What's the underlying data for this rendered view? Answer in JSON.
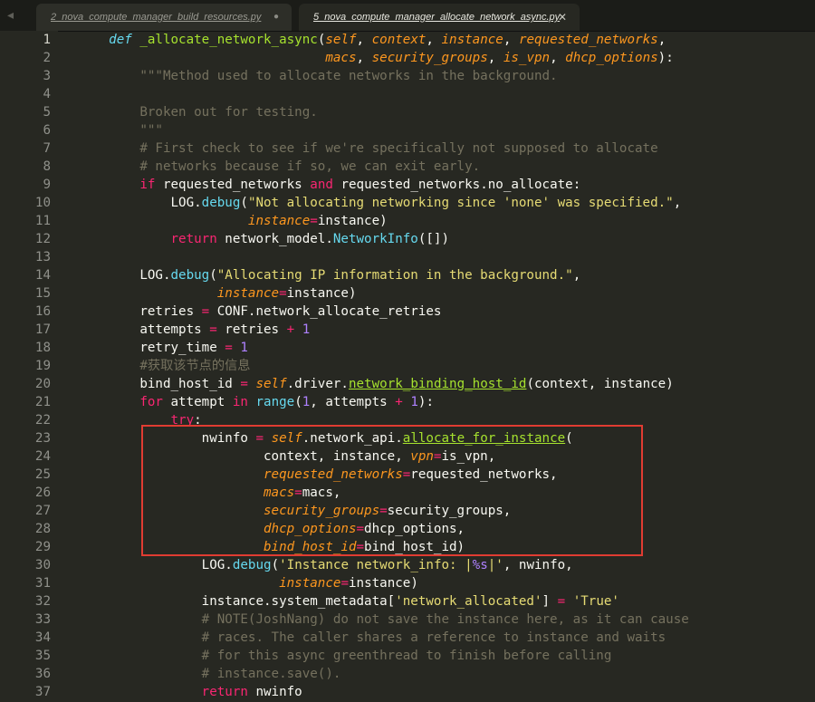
{
  "tabs": [
    {
      "label": "2_nova_compute_manager_build_resources.py",
      "state": "modified",
      "mark": "●"
    },
    {
      "label": "5_nova_compute_manager_allocate_network_async.py",
      "state": "active",
      "mark": "✕"
    }
  ],
  "line_numbers": [
    "1",
    "2",
    "3",
    "4",
    "5",
    "6",
    "7",
    "8",
    "9",
    "10",
    "11",
    "12",
    "13",
    "14",
    "15",
    "16",
    "17",
    "18",
    "19",
    "20",
    "21",
    "22",
    "23",
    "24",
    "25",
    "26",
    "27",
    "28",
    "29",
    "30",
    "31",
    "32",
    "33",
    "34",
    "35",
    "36",
    "37"
  ],
  "active_line": "1",
  "highlight_box": {
    "color": "#e03c32",
    "from_line": "23",
    "to_line": "29"
  },
  "code": [
    [
      [
        "    ",
        ""
      ],
      [
        "def",
        "d"
      ],
      [
        " ",
        ""
      ],
      [
        "_allocate_network_async",
        "f"
      ],
      [
        "(",
        ""
      ],
      [
        "self",
        "p"
      ],
      [
        ", ",
        ""
      ],
      [
        "context",
        "p"
      ],
      [
        ", ",
        ""
      ],
      [
        "instance",
        "p"
      ],
      [
        ", ",
        ""
      ],
      [
        "requested_networks",
        "p"
      ],
      [
        ",",
        ""
      ]
    ],
    [
      [
        "                                ",
        ""
      ],
      [
        "macs",
        "p"
      ],
      [
        ", ",
        ""
      ],
      [
        "security_groups",
        "p"
      ],
      [
        ", ",
        ""
      ],
      [
        "is_vpn",
        "p"
      ],
      [
        ", ",
        ""
      ],
      [
        "dhcp_options",
        "p"
      ],
      [
        "):",
        ""
      ]
    ],
    [
      [
        "        ",
        ""
      ],
      [
        "\"\"\"Method used to allocate networks in the background.",
        "c"
      ]
    ],
    [
      [
        "",
        ""
      ]
    ],
    [
      [
        "        ",
        ""
      ],
      [
        "Broken out for testing.",
        "c"
      ]
    ],
    [
      [
        "        ",
        ""
      ],
      [
        "\"\"\"",
        "c"
      ]
    ],
    [
      [
        "        ",
        ""
      ],
      [
        "# First check to see if we're specifically not supposed to allocate",
        "c"
      ]
    ],
    [
      [
        "        ",
        ""
      ],
      [
        "# networks because if so, we can exit early.",
        "c"
      ]
    ],
    [
      [
        "        ",
        ""
      ],
      [
        "if",
        "k"
      ],
      [
        " requested_networks ",
        ""
      ],
      [
        "and",
        "k"
      ],
      [
        " requested_networks.no_allocate:",
        ""
      ]
    ],
    [
      [
        "            LOG.",
        ""
      ],
      [
        "debug",
        "fc"
      ],
      [
        "(",
        ""
      ],
      [
        "\"Not allocating networking since 'none' was specified.\"",
        "s"
      ],
      [
        ",",
        ""
      ]
    ],
    [
      [
        "                      ",
        ""
      ],
      [
        "instance",
        "p"
      ],
      [
        "=",
        "k"
      ],
      [
        "instance)",
        ""
      ]
    ],
    [
      [
        "            ",
        ""
      ],
      [
        "return",
        "k"
      ],
      [
        " network_model.",
        ""
      ],
      [
        "NetworkInfo",
        "fc"
      ],
      [
        "([])",
        ""
      ]
    ],
    [
      [
        "",
        ""
      ]
    ],
    [
      [
        "        LOG.",
        ""
      ],
      [
        "debug",
        "fc"
      ],
      [
        "(",
        ""
      ],
      [
        "\"Allocating IP information in the background.\"",
        "s"
      ],
      [
        ",",
        ""
      ]
    ],
    [
      [
        "                  ",
        ""
      ],
      [
        "instance",
        "p"
      ],
      [
        "=",
        "k"
      ],
      [
        "instance)",
        ""
      ]
    ],
    [
      [
        "        retries ",
        ""
      ],
      [
        "=",
        "k"
      ],
      [
        " CONF.network_allocate_retries",
        ""
      ]
    ],
    [
      [
        "        attempts ",
        ""
      ],
      [
        "=",
        "k"
      ],
      [
        " retries ",
        ""
      ],
      [
        "+",
        "k"
      ],
      [
        " ",
        ""
      ],
      [
        "1",
        "n"
      ]
    ],
    [
      [
        "        retry_time ",
        ""
      ],
      [
        "=",
        "k"
      ],
      [
        " ",
        ""
      ],
      [
        "1",
        "n"
      ]
    ],
    [
      [
        "        ",
        ""
      ],
      [
        "#获取该节点的信息",
        "c"
      ]
    ],
    [
      [
        "        bind_host_id ",
        ""
      ],
      [
        "=",
        "k"
      ],
      [
        " ",
        ""
      ],
      [
        "self",
        "p"
      ],
      [
        ".driver.",
        ""
      ],
      [
        "network_binding_host_id",
        "fu"
      ],
      [
        "(context, instance)",
        ""
      ]
    ],
    [
      [
        "        ",
        ""
      ],
      [
        "for",
        "k"
      ],
      [
        " attempt ",
        ""
      ],
      [
        "in",
        "k"
      ],
      [
        " ",
        ""
      ],
      [
        "range",
        "b"
      ],
      [
        "(",
        ""
      ],
      [
        "1",
        "n"
      ],
      [
        ", attempts ",
        ""
      ],
      [
        "+",
        "k"
      ],
      [
        " ",
        ""
      ],
      [
        "1",
        "n"
      ],
      [
        "):",
        ""
      ]
    ],
    [
      [
        "            ",
        ""
      ],
      [
        "try",
        "ku"
      ],
      [
        ":",
        ""
      ]
    ],
    [
      [
        "                nwinfo ",
        ""
      ],
      [
        "=",
        "k"
      ],
      [
        " ",
        ""
      ],
      [
        "self",
        "p"
      ],
      [
        ".network_api.",
        ""
      ],
      [
        "allocate_for_instance",
        "fu"
      ],
      [
        "(",
        ""
      ]
    ],
    [
      [
        "                        context, instance, ",
        ""
      ],
      [
        "vpn",
        "p"
      ],
      [
        "=",
        "k"
      ],
      [
        "is_vpn,",
        ""
      ]
    ],
    [
      [
        "                        ",
        ""
      ],
      [
        "requested_networks",
        "p"
      ],
      [
        "=",
        "k"
      ],
      [
        "requested_networks,",
        ""
      ]
    ],
    [
      [
        "                        ",
        ""
      ],
      [
        "macs",
        "p"
      ],
      [
        "=",
        "k"
      ],
      [
        "macs,",
        ""
      ]
    ],
    [
      [
        "                        ",
        ""
      ],
      [
        "security_groups",
        "p"
      ],
      [
        "=",
        "k"
      ],
      [
        "security_groups,",
        ""
      ]
    ],
    [
      [
        "                        ",
        ""
      ],
      [
        "dhcp_options",
        "p"
      ],
      [
        "=",
        "k"
      ],
      [
        "dhcp_options,",
        ""
      ]
    ],
    [
      [
        "                        ",
        ""
      ],
      [
        "bind_host_id",
        "p"
      ],
      [
        "=",
        "k"
      ],
      [
        "bind_host_id)",
        ""
      ]
    ],
    [
      [
        "                LOG.",
        ""
      ],
      [
        "debug",
        "fc"
      ],
      [
        "(",
        ""
      ],
      [
        "'Instance network_info: |",
        "s"
      ],
      [
        "%s",
        "n"
      ],
      [
        "|'",
        "s"
      ],
      [
        ", nwinfo,",
        ""
      ]
    ],
    [
      [
        "                          ",
        ""
      ],
      [
        "instance",
        "p"
      ],
      [
        "=",
        "k"
      ],
      [
        "instance)",
        ""
      ]
    ],
    [
      [
        "                instance.system_metadata[",
        ""
      ],
      [
        "'network_allocated'",
        "s"
      ],
      [
        "] ",
        ""
      ],
      [
        "=",
        "k"
      ],
      [
        " ",
        ""
      ],
      [
        "'True'",
        "s"
      ]
    ],
    [
      [
        "                ",
        ""
      ],
      [
        "# NOTE(JoshNang) do not save the instance here, as it can cause",
        "c"
      ]
    ],
    [
      [
        "                ",
        ""
      ],
      [
        "# races. The caller shares a reference to instance and waits",
        "c"
      ]
    ],
    [
      [
        "                ",
        ""
      ],
      [
        "# for this async greenthread to finish before calling",
        "c"
      ]
    ],
    [
      [
        "                ",
        ""
      ],
      [
        "# instance.save().",
        "c"
      ]
    ],
    [
      [
        "                ",
        ""
      ],
      [
        "return",
        "k"
      ],
      [
        " nwinfo",
        ""
      ]
    ]
  ]
}
